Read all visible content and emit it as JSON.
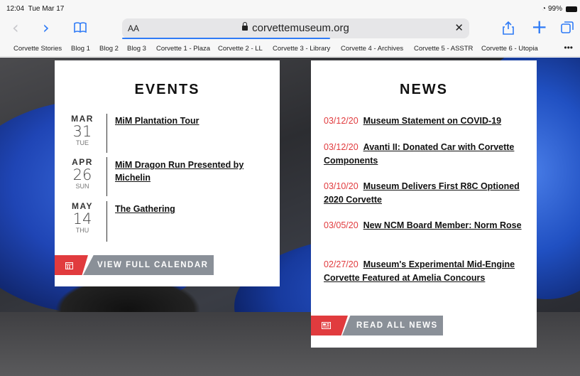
{
  "status_bar": {
    "time": "12:04",
    "date": "Tue Mar 17",
    "battery": "99%"
  },
  "toolbar": {
    "text_size_label": "AA",
    "url": "corvettemuseum.org"
  },
  "bookmarks": [
    "Corvette Stories",
    "Blog 1",
    "Blog 2",
    "Blog 3",
    "Corvette 1 - Plaza",
    "Corvette 2 - LL",
    "Corvette 3 - Library",
    "Corvette 4 - Archives",
    "Corvette 5 - ASSTR",
    "Corvette 6 - Utopia"
  ],
  "events": {
    "title": "EVENTS",
    "items": [
      {
        "month": "MAR",
        "day": "31",
        "weekday": "TUE",
        "name": "MiM Plantation Tour"
      },
      {
        "month": "APR",
        "day": "26",
        "weekday": "SUN",
        "name": "MiM Dragon Run Presented by Michelin"
      },
      {
        "month": "MAY",
        "day": "14",
        "weekday": "THU",
        "name": "The Gathering"
      }
    ],
    "cta_label": "VIEW FULL CALENDAR"
  },
  "news": {
    "title": "NEWS",
    "items": [
      {
        "date": "03/12/20",
        "headline": "Museum Statement on COVID-19"
      },
      {
        "date": "03/12/20",
        "headline": "Avanti II: Donated Car with Corvette Components"
      },
      {
        "date": "03/10/20",
        "headline": "Museum Delivers First R8C Optioned 2020 Corvette"
      },
      {
        "date": "03/05/20",
        "headline": "New NCM Board Member: Norm Rose"
      },
      {
        "date": "02/27/20",
        "headline": "Museum's Experimental Mid-Engine Corvette Featured at Amelia Concours"
      }
    ],
    "cta_label": "READ ALL NEWS"
  },
  "colors": {
    "accent_red": "#e13b3e",
    "cta_gray": "#8a9098",
    "link_blue": "#2f7bf6"
  }
}
